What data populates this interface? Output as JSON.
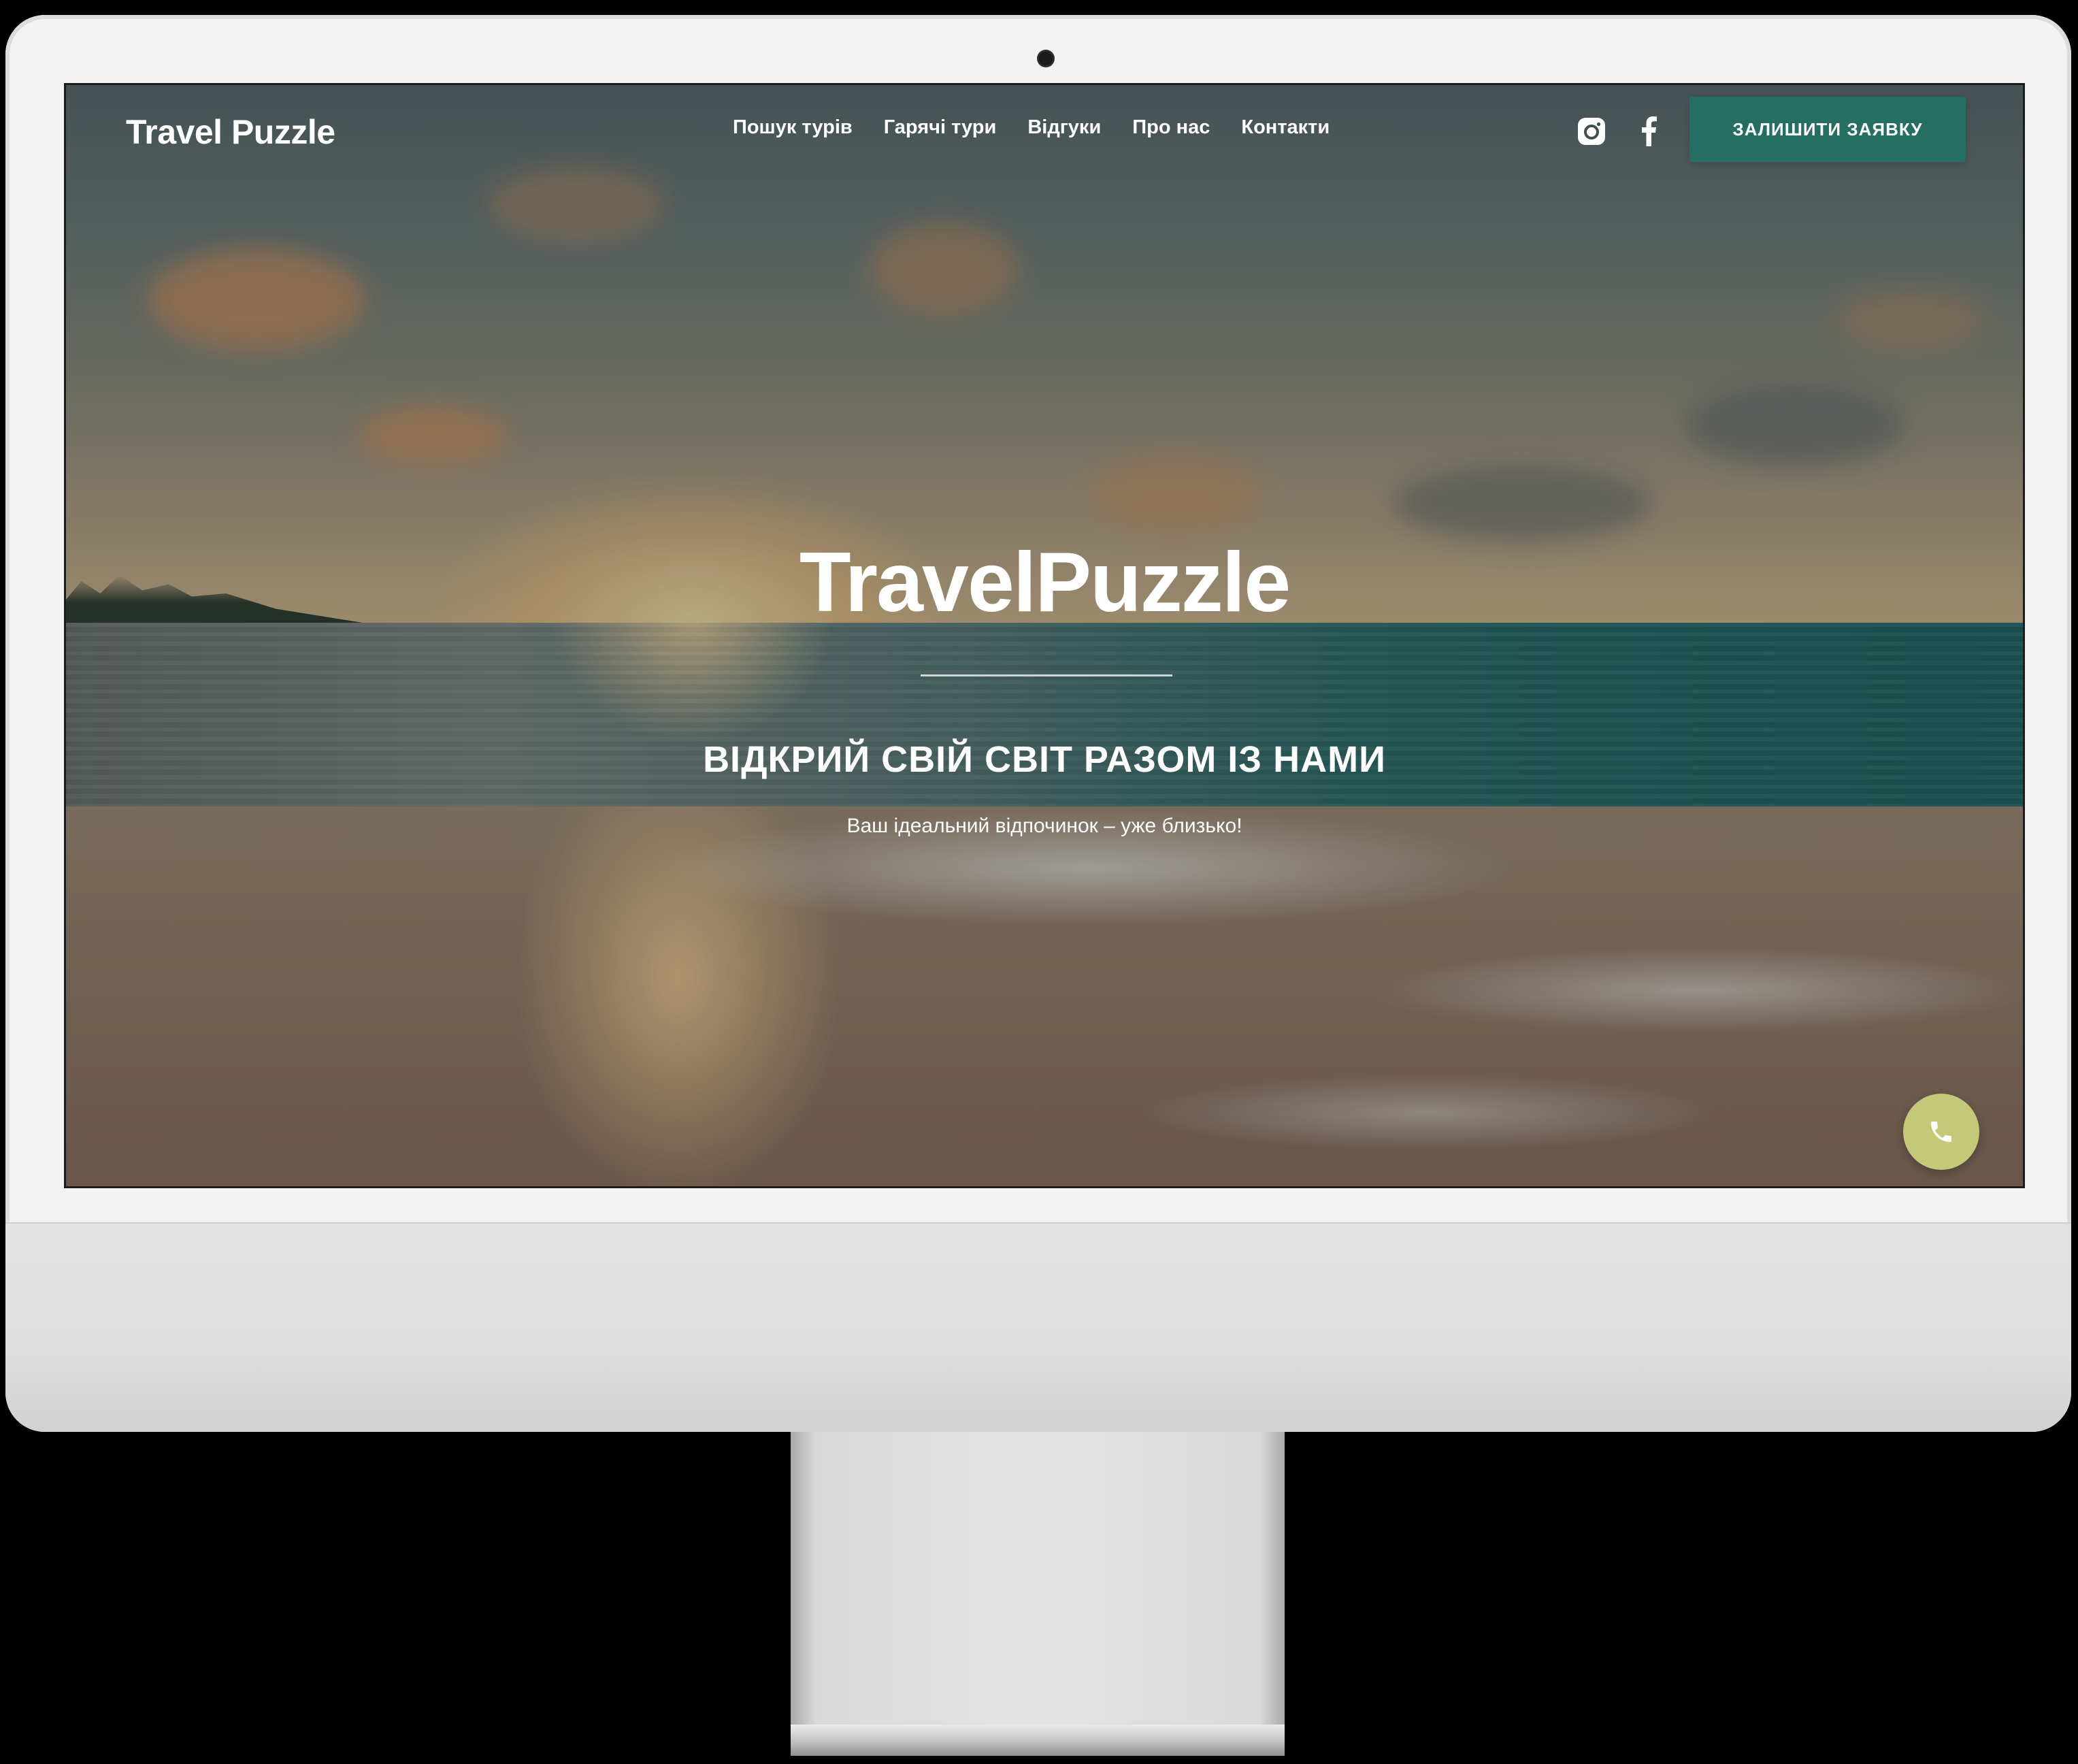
{
  "header": {
    "logo": "Travel Puzzle",
    "nav": [
      {
        "label": "Пошук турів"
      },
      {
        "label": "Гарячі тури"
      },
      {
        "label": "Відгуки"
      },
      {
        "label": "Про нас"
      },
      {
        "label": "Контакти"
      }
    ],
    "social_icons": [
      "instagram-icon",
      "facebook-icon"
    ],
    "cta_label": "ЗАЛИШИТИ ЗАЯВКУ",
    "cta_color": "#256f62"
  },
  "hero": {
    "logo": "TravelPuzzle",
    "title": "ВІДКРИЙ СВІЙ СВІТ РАЗОМ ІЗ НАМИ",
    "subtitle": "Ваш ідеальний відпочинок – уже близько!"
  },
  "call_button": {
    "icon": "phone-icon",
    "color": "#c4c97a"
  }
}
